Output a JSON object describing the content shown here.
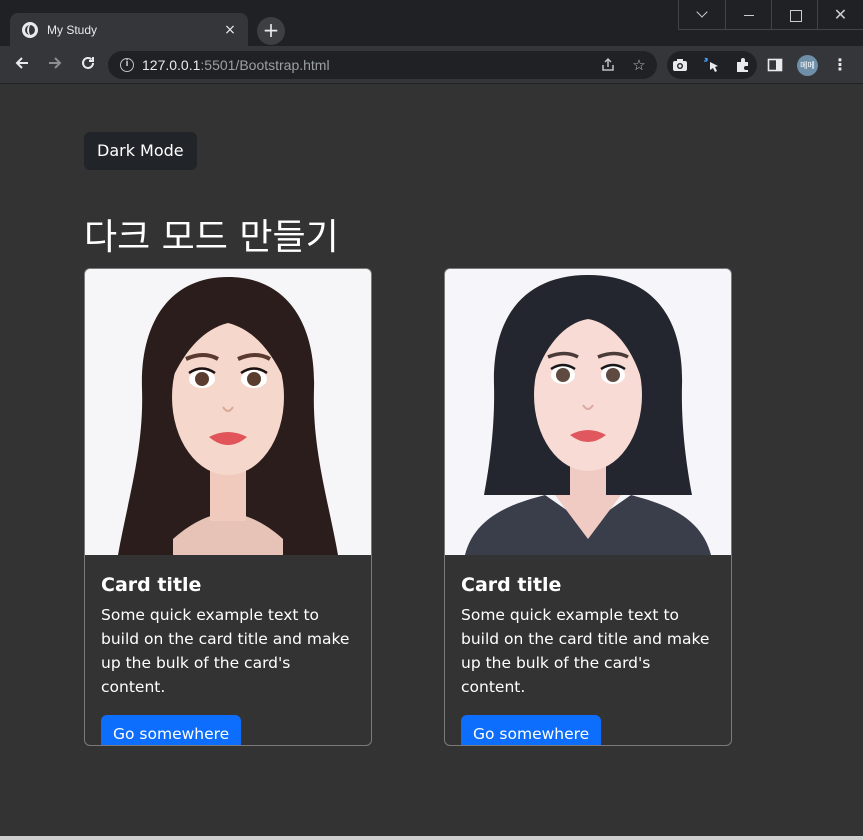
{
  "browser": {
    "tab_title": "My Study",
    "tab_close": "×",
    "new_tab": "+",
    "url_host": "127.0.0.1",
    "url_path": ":5501/Bootstrap.html",
    "profile_initials": "메메",
    "window_close": "✕"
  },
  "page": {
    "dark_mode_button": "Dark Mode",
    "heading": "다크 모드 만들기"
  },
  "cards": [
    {
      "title": "Card title",
      "text": "Some quick example text to build on the card title and make up the bulk of the card's content.",
      "button": "Go somewhere",
      "image": "long-hair-portrait"
    },
    {
      "title": "Card title",
      "text": "Some quick example text to build on the card title and make up the bulk of the card's content.",
      "button": "Go somewhere",
      "image": "short-hair-portrait"
    }
  ],
  "colors": {
    "page_bg": "#333333",
    "primary": "#0d6efd",
    "dark_button": "#212529"
  }
}
